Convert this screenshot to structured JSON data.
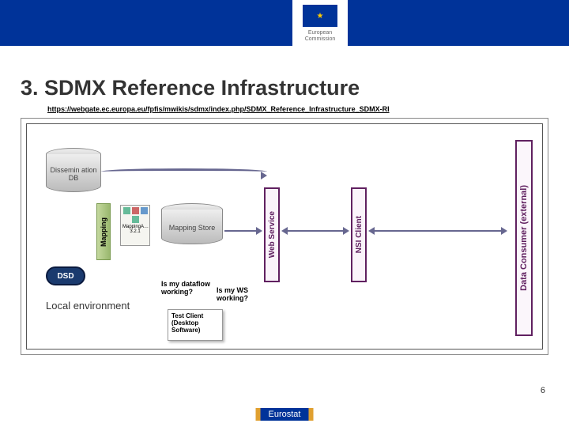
{
  "header": {
    "org": "European Commission"
  },
  "title": "3. SDMX Reference Infrastructure",
  "url": "https://webgate.ec.europa.eu/fpfis/mwikis/sdmx/index.php/SDMX_Reference_Infrastructure_SDMX-RI",
  "nodes": {
    "dissem_db": "Dissemin ation DB",
    "mapping_col": "Mapping",
    "ma_label": "MappingA… 3.2.1",
    "mapping_store": "Mapping Store",
    "dsd": "DSD",
    "local_env": "Local environment",
    "web_service": "Web Service",
    "nsi_client": "NSI Client",
    "data_consumer": "Data Consumer (external)"
  },
  "questions": {
    "q1": "Is my dataflow working?",
    "q2": "Is my WS working?"
  },
  "test_client": "Test Client (Desktop Software)",
  "page_number": "6",
  "footer": "Eurostat"
}
